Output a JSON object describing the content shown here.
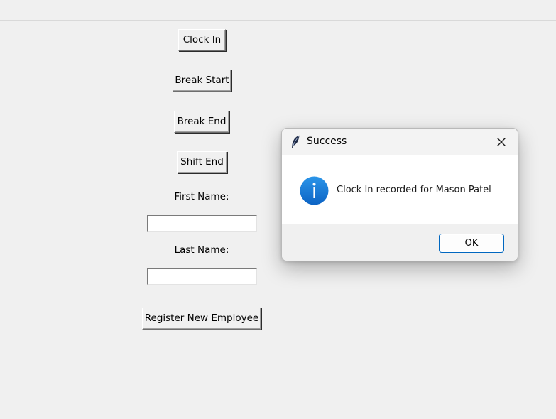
{
  "main": {
    "clock_in_label": "Clock In",
    "break_start_label": "Break Start",
    "break_end_label": "Break End",
    "shift_end_label": "Shift End",
    "first_name_label": "First Name:",
    "first_name_value": "",
    "last_name_label": "Last Name:",
    "last_name_value": "",
    "register_label": "Register New Employee"
  },
  "dialog": {
    "title": "Success",
    "message": "Clock In recorded for Mason Patel",
    "ok_label": "OK",
    "app_icon": "feather-icon",
    "message_icon": "info-icon",
    "close_icon": "close-icon",
    "accent_color": "#0067c0",
    "info_color": "#1a7fd6"
  }
}
